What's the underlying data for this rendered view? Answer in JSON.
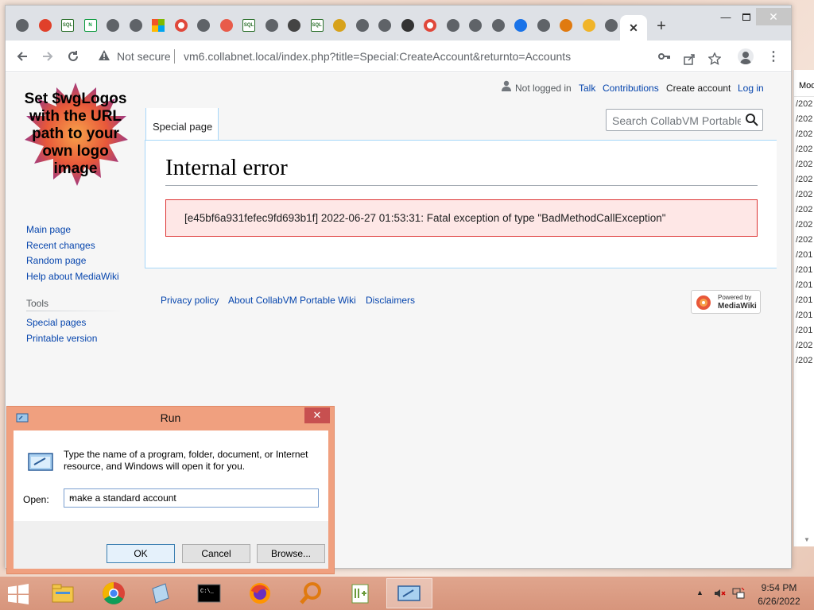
{
  "browser": {
    "tabs": [
      {
        "icon": "chrome-globe-icon",
        "color": "#5f6368"
      },
      {
        "icon": "red-app-icon",
        "color": "#e0402a"
      },
      {
        "icon": "sql-icon",
        "text": "SQL",
        "color": "#2a6f2a"
      },
      {
        "icon": "nginx-icon",
        "text": "N",
        "color": "#0c9a3e"
      },
      {
        "icon": "globe-icon",
        "color": "#5f6368"
      },
      {
        "icon": "globe-icon",
        "color": "#5f6368"
      },
      {
        "icon": "windows-icon",
        "color": "#f35325"
      },
      {
        "icon": "ring-icon",
        "color": "#e0483b"
      },
      {
        "icon": "globe-icon",
        "color": "#5f6368"
      },
      {
        "icon": "calendar-icon",
        "color": "#e85b4a"
      },
      {
        "icon": "sql-icon",
        "text": "SQL",
        "color": "#2a6f2a"
      },
      {
        "icon": "globe-icon",
        "color": "#5f6368"
      },
      {
        "icon": "diamond-icon",
        "color": "#444"
      },
      {
        "icon": "sql-icon",
        "text": "SQL",
        "color": "#2a6f2a"
      },
      {
        "icon": "archive-icon",
        "color": "#d7a21b"
      },
      {
        "icon": "gear-icon",
        "color": "#5f6368"
      },
      {
        "icon": "globe-icon",
        "color": "#5f6368"
      },
      {
        "icon": "tor-icon",
        "color": "#333"
      },
      {
        "icon": "ring-icon",
        "color": "#e0483b"
      },
      {
        "icon": "globe-icon",
        "color": "#5f6368"
      },
      {
        "icon": "globe-icon",
        "color": "#5f6368"
      },
      {
        "icon": "gear-icon",
        "color": "#5f6368"
      },
      {
        "icon": "cloud-icon",
        "color": "#1a73e8"
      },
      {
        "icon": "globe-icon",
        "color": "#5f6368"
      },
      {
        "icon": "magnifier-icon",
        "color": "#e07a10"
      },
      {
        "icon": "sun-icon",
        "color": "#f0b429"
      },
      {
        "icon": "chrome-icon",
        "color": "#5f6368"
      }
    ],
    "address": {
      "security_label": "Not secure",
      "url": "vm6.collabnet.local/index.php?title=Special:CreateAccount&returnto=Accounts"
    }
  },
  "wiki": {
    "logo_text": "Set $wgLogos with the URL path to your own logo image",
    "personal": {
      "status": "Not logged in",
      "talk": "Talk",
      "contributions": "Contributions",
      "create_account": "Create account",
      "login": "Log in"
    },
    "namespace_tab": "Special page",
    "search_placeholder": "Search CollabVM Portable Wiki",
    "sidebar": {
      "navigation": [
        "Main page",
        "Recent changes",
        "Random page",
        "Help about MediaWiki"
      ],
      "tools_heading": "Tools",
      "tools": [
        "Special pages",
        "Printable version"
      ]
    },
    "heading": "Internal error",
    "error_message": "[e45bf6a931fefec9fd693b1f] 2022-06-27 01:53:31: Fatal exception of type \"BadMethodCallException\"",
    "footer": {
      "privacy": "Privacy policy",
      "about": "About CollabVM Portable Wiki",
      "disclaimers": "Disclaimers",
      "powered_line1": "Powered by",
      "powered_line2": "MediaWiki"
    }
  },
  "behind_window": {
    "header": "Mod",
    "rows": [
      "/202",
      "/202",
      "/202",
      "/202",
      "/202",
      "/202",
      "/202",
      "/202",
      "/202",
      "/202",
      "/201",
      "/201",
      "/201",
      "/201",
      "/201",
      "/201",
      "/202",
      "/202"
    ]
  },
  "run_dialog": {
    "title": "Run",
    "description": "Type the name of a program, folder, document, or Internet resource, and Windows will open it for you.",
    "open_label": "Open:",
    "open_value": "make a standard account",
    "ok": "OK",
    "cancel": "Cancel",
    "browse": "Browse..."
  },
  "taskbar": {
    "apps": [
      "file-explorer-icon",
      "chrome-icon",
      "notepad-icon",
      "cmd-icon",
      "firefox-icon",
      "magnifier-icon",
      "notepad-plus-icon",
      "run-icon"
    ],
    "time": "9:54 PM",
    "date": "6/26/2022"
  },
  "colors": {
    "link": "#0645ad",
    "error_bg": "#fee7e6",
    "error_border": "#dd3333",
    "run_frame": "#f0a07f",
    "taskbar": "#d7957c"
  }
}
